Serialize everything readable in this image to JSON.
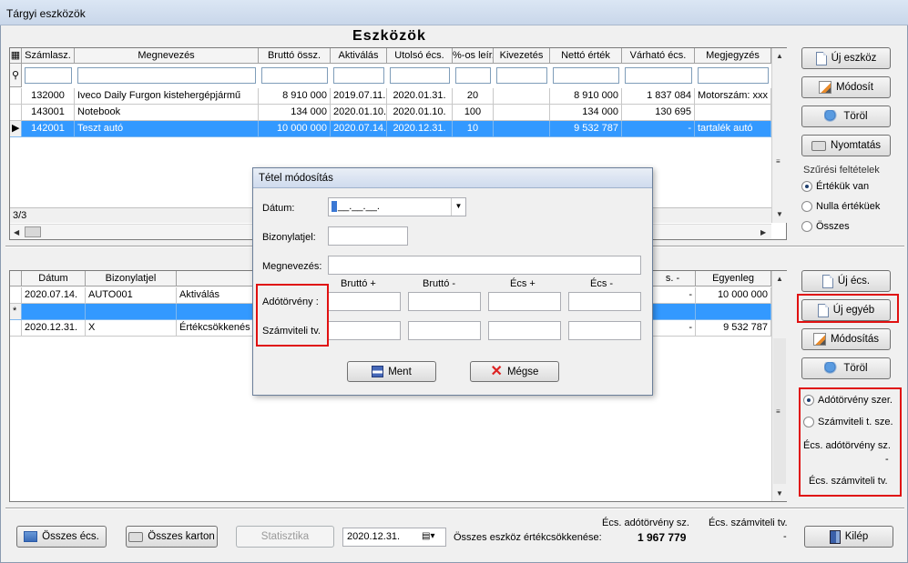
{
  "window": {
    "title": "Tárgyi eszközök"
  },
  "heading": "Eszközök",
  "assets": {
    "columns": [
      "Számlasz.",
      "Megnevezés",
      "Bruttó össz.",
      "Aktiválás",
      "Utolsó écs.",
      "%-os leír.",
      "Kivezetés",
      "Nettó érték",
      "Várható écs.",
      "Megjegyzés"
    ],
    "rows": [
      [
        "132000",
        "Iveco Daily Furgon kistehergépjármű",
        "8 910 000",
        "2019.07.11.",
        "2020.01.31.",
        "20",
        "",
        "8 910 000",
        "1 837 084",
        "Motorszám: xxx"
      ],
      [
        "143001",
        "Notebook",
        "134 000",
        "2020.01.10.",
        "2020.01.10.",
        "100",
        "",
        "134 000",
        "130 695",
        ""
      ],
      [
        "142001",
        "Teszt autó",
        "10 000 000",
        "2020.07.14.",
        "2020.12.31.",
        "10",
        "",
        "9 532 787",
        "-",
        "tartalék autó"
      ]
    ],
    "record_count": "3/3"
  },
  "right_buttons": {
    "new_asset": "Új eszköz",
    "modify": "Módosít",
    "delete": "Töröl",
    "print": "Nyomtatás"
  },
  "filter": {
    "title": "Szűrési feltételek",
    "options": [
      "Értékük van",
      "Nulla értéküek",
      "Összes"
    ]
  },
  "entries": {
    "columns": [
      "Dátum",
      "Bizonylatjel",
      "",
      "s. -",
      "Egyenleg"
    ],
    "rows": [
      [
        "2020.07.14.",
        "AUTO001",
        "Aktiválás",
        "-",
        "10 000 000"
      ],
      [
        "",
        "",
        "",
        "",
        ""
      ],
      [
        "2020.12.31.",
        "X",
        "Értékcsökkenés",
        "-",
        "9 532 787"
      ]
    ],
    "row_markers": [
      "",
      "*",
      ""
    ]
  },
  "entry_buttons": {
    "new_dep": "Új écs.",
    "new_other": "Új egyéb",
    "modify": "Módosítás",
    "delete": "Töröl"
  },
  "mode": {
    "options": [
      "Adótörvény szer.",
      "Számviteli t. sze."
    ],
    "tax_label": "Écs. adótörvény sz.",
    "tax_value": "-",
    "acc_label": "Écs. számviteli tv."
  },
  "dialog": {
    "title": "Tétel módosítás",
    "date_label": "Dátum:",
    "date_value": "__.__.__.",
    "doc_label": "Bizonylatjel:",
    "name_label": "Megnevezés:",
    "col_headers": [
      "Bruttó +",
      "Bruttó -",
      "Écs +",
      "Écs -"
    ],
    "row_labels": [
      "Adótörvény :",
      "Számviteli tv."
    ],
    "save": "Ment",
    "cancel": "Mégse"
  },
  "bottom": {
    "total_dep": "Összes écs.",
    "total_card": "Összes karton",
    "stats": "Statisztika",
    "date": "2020.12.31.",
    "summary_label": "Összes eszköz értékcsökkenése:",
    "tax_header": "Écs. adótörvény sz.",
    "tax_value": "1 967 779",
    "acc_header": "Écs. számviteli tv.",
    "acc_value": "-",
    "exit": "Kilép"
  }
}
